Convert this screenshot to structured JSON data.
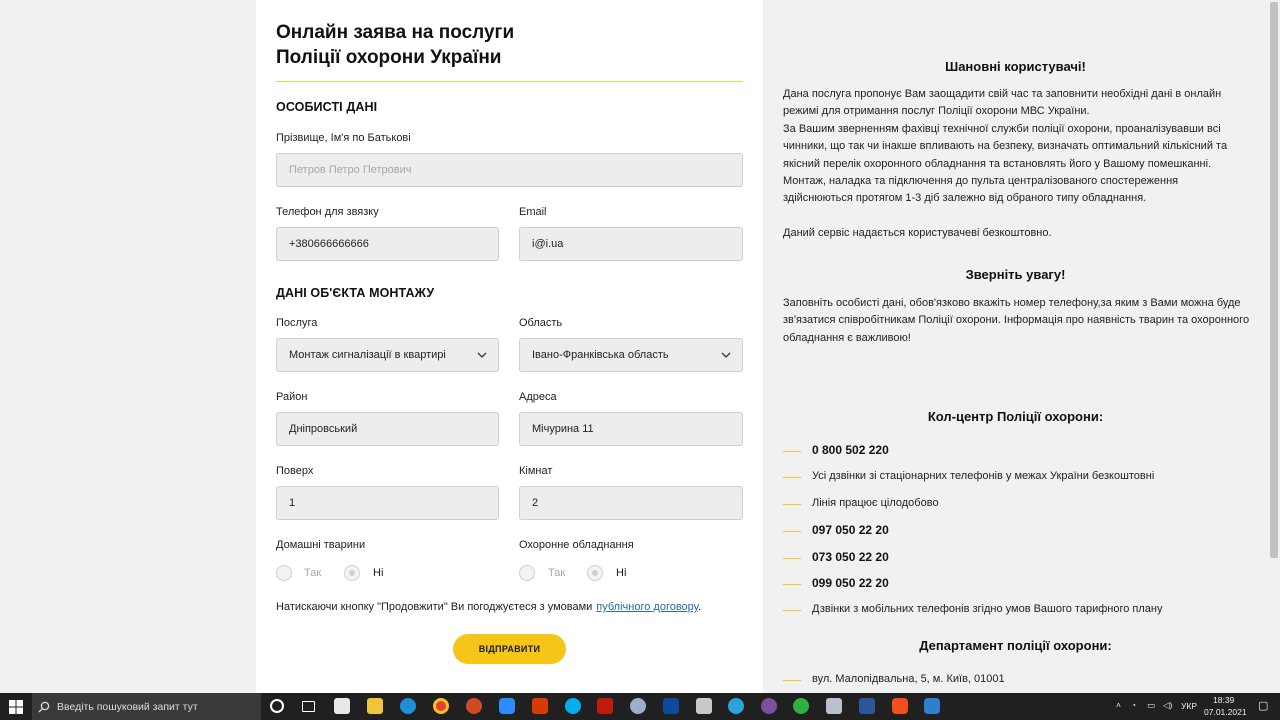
{
  "form": {
    "title_line1": "Онлайн заява на послуги",
    "title_line2": "Поліції охорони України",
    "personal_heading": "ОСОБИСТІ ДАНІ",
    "fullname_label": "Прізвище, Ім'я по Батькові",
    "fullname_placeholder": "Петров Петро Петрович",
    "phone_label": "Телефон для звязку",
    "phone_value": "+380666666666",
    "email_label": "Email",
    "email_value": "i@i.ua",
    "object_heading": "ДАНІ ОБ'ЄКТА МОНТАЖУ",
    "service_label": "Послуга",
    "service_value": "Монтаж сигналізації в квартирі",
    "region_label": "Область",
    "region_value": "Івано-Франківська область",
    "district_label": "Район",
    "district_value": "Дніпровський",
    "address_label": "Адреса",
    "address_value": "Мічурина 11",
    "floor_label": "Поверх",
    "floor_value": "1",
    "rooms_label": "Кімнат",
    "rooms_value": "2",
    "pets_label": "Домашні тварини",
    "equipment_label": "Охоронне обладнання",
    "yes": "Так",
    "no": "Ні",
    "agree_text": "Натискаючи кнопку \"Продовжити\" Ви погоджуєтеся з умовами",
    "agree_link": "публічного договору",
    "agree_end": ".",
    "submit_label": "ВІДПРАВИТИ"
  },
  "info": {
    "heading1": "Шановні користувачі!",
    "para1_lines": [
      "Дана послуга пропонує Вам заощадити свій час та заповнити необхідні дані в онлайн",
      "режимі для отримання послуг Поліції охорони МВС України.",
      "За Вашим зверненням фахівці технічної служби поліції охорони, проаналізувавши всі",
      "чинники, що так чи інакше впливають на безпеку, визначать оптимальний кількісний та",
      "якісний перелік охоронного обладнання та встановлять його у Вашому помешканні.",
      "Монтаж, наладка та підключення до пульта централізованого спостереження",
      "здійснюються протягом 1-3 діб залежно від обраного типу обладнання."
    ],
    "para2": "Даний сервіс надається користувачеві безкоштовно.",
    "heading2": "Зверніть увагу!",
    "para3_lines": [
      "Заповніть особисті дані, обов'язково вкажіть номер телефону,за яким з Вами можна буде",
      "зв'язатися співробітникам Поліції охорони. Інформація про наявність тварин та охоронного",
      "обладнання є важливою!"
    ],
    "heading3": "Кол-центр Поліції охорони:",
    "contacts": [
      "0 800 502 220",
      "Усі дзвінки зі стаціонарних телефонів у межах України безкоштовні",
      "Лінія працює цілодобово",
      "097 050 22 20",
      "073 050 22 20",
      "099 050 22 20",
      "Дзвінки з мобільних телефонів згідно умов Вашого тарифного плану"
    ],
    "heading4": "Департамент поліції охорони:",
    "address": "вул. Малопідвальна, 5, м. Київ, 01001"
  },
  "taskbar": {
    "search_placeholder": "Введіть пошуковий запит тут",
    "lang": "УКР",
    "time": "18:39",
    "date": "07.01.2021",
    "apps": [
      "task-view",
      "store",
      "file-explorer",
      "edge",
      "chrome",
      "powerpoint",
      "zoom",
      "office",
      "skype",
      "filezilla",
      "settings",
      "app-blue",
      "app-z",
      "telegram",
      "viber",
      "whatsapp",
      "printer",
      "word",
      "figma",
      "app-chat"
    ]
  }
}
